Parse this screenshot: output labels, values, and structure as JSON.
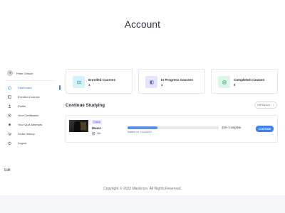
{
  "page": {
    "title": "Account"
  },
  "sidebar": {
    "user": {
      "name": "Peter Grissin"
    },
    "items": [
      {
        "label": "Dashboard",
        "icon": "dashboard-icon",
        "active": true
      },
      {
        "label": "Enrolled Courses",
        "icon": "book-icon"
      },
      {
        "label": "Profile",
        "icon": "user-icon"
      },
      {
        "label": "Your Certificates",
        "icon": "certificate-icon"
      },
      {
        "label": "Your Quiz Attempts",
        "icon": "star-icon"
      },
      {
        "label": "Order History",
        "icon": "cart-icon"
      },
      {
        "label": "Logout",
        "icon": "logout-icon"
      }
    ]
  },
  "stats": [
    {
      "label": "Enrolled Courses",
      "count": "1",
      "icon": "enrolled-courses-icon",
      "color": "#d6f2f8",
      "icon_color": "#25a7c4"
    },
    {
      "label": "In Progress Courses",
      "count": "1",
      "icon": "in-progress-icon",
      "color": "#e4e5fb",
      "icon_color": "#5b61d6"
    },
    {
      "label": "Completed Courses",
      "count": "0",
      "icon": "completed-courses-icon",
      "color": "#ddf5e6",
      "icon_color": "#2fa864"
    }
  ],
  "continue": {
    "title": "Continue Studying",
    "show_all": "SHOW ALL",
    "course": {
      "tag": "Classic",
      "title": "Music",
      "duration": "28h",
      "progress": 33,
      "progress_text": "33% Complete",
      "started": "Started on: 11/24/2022",
      "button": "CONTINUE"
    }
  },
  "edit_link": "Edit",
  "footer": {
    "copyright": "Copyright © 2022 Masteriyo. All Rights Reserved."
  },
  "colors": {
    "accent": "#3b82f6",
    "tag_bg": "#e3e1ff",
    "tag_text": "#6d5ed8"
  }
}
